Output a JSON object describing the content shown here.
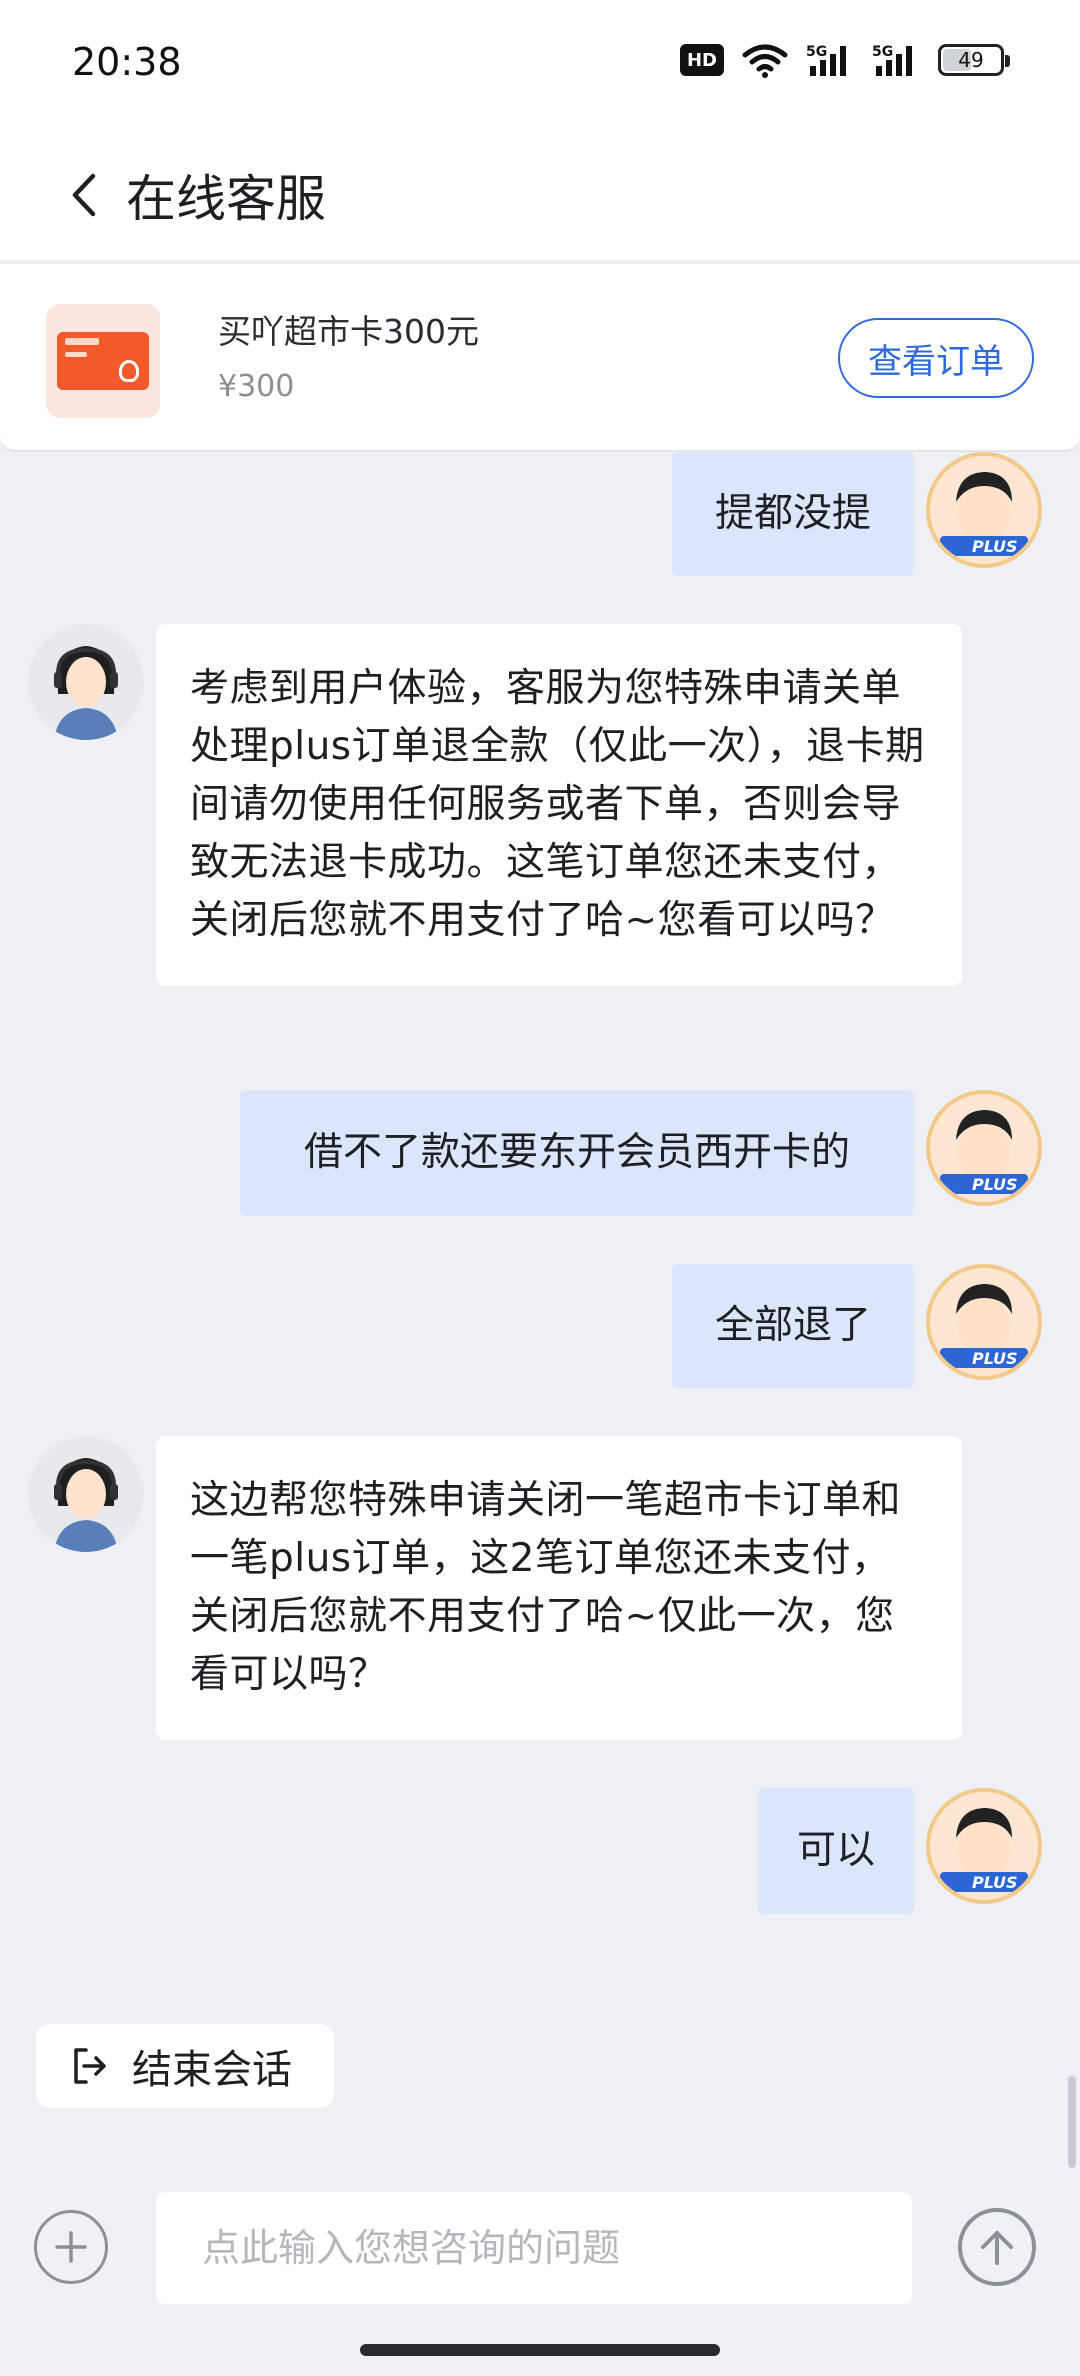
{
  "status_bar": {
    "time": "20:38",
    "hd_badge": "HD",
    "battery_level": "49",
    "icons": [
      "hd-voice-icon",
      "wifi-icon",
      "signal-5g-icon",
      "signal-5g-icon",
      "battery-icon"
    ]
  },
  "header": {
    "title": "在线客服",
    "back_icon": "chevron-left-icon"
  },
  "order_card": {
    "product_name": "买吖超市卡300元",
    "price": "¥300",
    "view_order_label": "查看订单"
  },
  "messages": [
    {
      "sender": "user",
      "text": "提都没提"
    },
    {
      "sender": "agent",
      "text": "考虑到用户体验，客服为您特殊申请关单处理plus订单退全款（仅此一次），退卡期间请勿使用任何服务或者下单，否则会导致无法退卡成功。这笔订单您还未支付，关闭后您就不用支付了哈~您看可以吗？"
    },
    {
      "sender": "user",
      "text": "借不了款还要东开会员西开卡的"
    },
    {
      "sender": "user",
      "text": "全部退了"
    },
    {
      "sender": "agent",
      "text": "这边帮您特殊申请关闭一笔超市卡订单和一笔plus订单，这2笔订单您还未支付，关闭后您就不用支付了哈~仅此一次，您看可以吗？"
    },
    {
      "sender": "user",
      "text": "可以"
    }
  ],
  "user_avatar_badge": "PLUS",
  "end_session_label": "结束会话",
  "input": {
    "placeholder": "点此输入您想咨询的问题",
    "value": ""
  },
  "colors": {
    "accent": "#2f6ad9",
    "user_bubble": "#dce6fb",
    "agent_bubble": "#ffffff",
    "background": "#eef0f6"
  }
}
